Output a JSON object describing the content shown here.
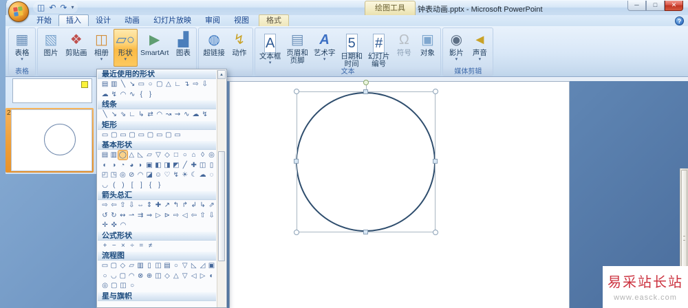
{
  "titlebar": {
    "context_header": "绘图工具",
    "title": "钟表动画.pptx - Microsoft PowerPoint",
    "qat": [
      {
        "name": "save-icon",
        "glyph": "◫"
      },
      {
        "name": "undo-icon",
        "glyph": "↶"
      },
      {
        "name": "redo-icon",
        "glyph": "↷"
      },
      {
        "name": "qat-more-icon",
        "glyph": "▾"
      }
    ],
    "window_buttons": [
      {
        "name": "minimize-button",
        "glyph": "─"
      },
      {
        "name": "maximize-button",
        "glyph": "□"
      },
      {
        "name": "close-button",
        "glyph": "✕"
      }
    ],
    "help_glyph": "?"
  },
  "tabs": [
    {
      "label": "开始",
      "active": false,
      "context": false
    },
    {
      "label": "插入",
      "active": true,
      "context": false
    },
    {
      "label": "设计",
      "active": false,
      "context": false
    },
    {
      "label": "动画",
      "active": false,
      "context": false
    },
    {
      "label": "幻灯片放映",
      "active": false,
      "context": false
    },
    {
      "label": "审阅",
      "active": false,
      "context": false
    },
    {
      "label": "视图",
      "active": false,
      "context": false
    },
    {
      "label": "格式",
      "active": false,
      "context": true
    }
  ],
  "ribbon": {
    "groups": [
      {
        "name": "tables",
        "label": "表格",
        "buttons": [
          {
            "label": "表格",
            "icon": "table-icon",
            "glyph": "▦",
            "arrow": true
          }
        ]
      },
      {
        "name": "illustrations",
        "label": "",
        "buttons": [
          {
            "label": "图片",
            "icon": "picture-icon",
            "glyph": "▧"
          },
          {
            "label": "剪贴画",
            "icon": "clipart-icon",
            "glyph": "❖"
          },
          {
            "label": "相册",
            "icon": "photo-album-icon",
            "glyph": "◫",
            "arrow": true
          },
          {
            "label": "形状",
            "icon": "shapes-icon",
            "glyph": "▱○",
            "arrow": true,
            "active": true
          },
          {
            "label": "SmartArt",
            "icon": "smartart-icon",
            "glyph": "▶"
          },
          {
            "label": "图表",
            "icon": "chart-icon",
            "glyph": "▟"
          }
        ]
      },
      {
        "name": "links",
        "label": "",
        "buttons": [
          {
            "label": "超链接",
            "icon": "hyperlink-icon",
            "glyph": "◍"
          },
          {
            "label": "动作",
            "icon": "action-icon",
            "glyph": "↯"
          }
        ]
      },
      {
        "name": "text",
        "label": "文本",
        "buttons": [
          {
            "label": "文本框",
            "icon": "textbox-icon",
            "glyph": "A",
            "arrow": true
          },
          {
            "label": "页眉和\n页脚",
            "icon": "header-footer-icon",
            "glyph": "▤"
          },
          {
            "label": "艺术字",
            "icon": "wordart-icon",
            "glyph": "A",
            "arrow": true
          },
          {
            "label": "日期和\n时间",
            "icon": "date-time-icon",
            "glyph": "5"
          },
          {
            "label": "幻灯片\n编号",
            "icon": "slide-number-icon",
            "glyph": "#"
          },
          {
            "label": "符号",
            "icon": "symbol-icon",
            "glyph": "Ω",
            "disabled": true
          },
          {
            "label": "对象",
            "icon": "object-icon",
            "glyph": "▣"
          }
        ]
      },
      {
        "name": "media",
        "label": "媒体剪辑",
        "buttons": [
          {
            "label": "影片",
            "icon": "movie-icon",
            "glyph": "◉",
            "arrow": true
          },
          {
            "label": "声音",
            "icon": "sound-icon",
            "glyph": "◄",
            "arrow": true
          }
        ]
      }
    ]
  },
  "shapes_menu": {
    "scroll_up_glyph": "▲",
    "sections": [
      {
        "title": "最近使用的形状",
        "rows": [
          [
            "▤",
            "▥",
            "╲",
            "↘",
            "▭",
            "○",
            "▢",
            "△",
            "∟",
            "↴",
            "⇨",
            "⇩"
          ],
          [
            "☁",
            "↯",
            "◠",
            "∿",
            "{",
            "}"
          ]
        ]
      },
      {
        "title": "线条",
        "rows": [
          [
            "╲",
            "↘",
            "⇘",
            "∟",
            "↳",
            "⇄",
            "◠",
            "↝",
            "⇝",
            "∿",
            "☁",
            "↯"
          ]
        ]
      },
      {
        "title": "矩形",
        "rows": [
          [
            "▭",
            "▢",
            "▭",
            "▢",
            "▭",
            "▢",
            "▭",
            "▢",
            "▭"
          ]
        ]
      },
      {
        "title": "基本形状",
        "highlighted_cell": [
          0,
          2
        ],
        "rows": [
          [
            "▤",
            "▥",
            "◯",
            "△",
            "◺",
            "▱",
            "▽",
            "◇",
            "□",
            "○",
            "⌂",
            "◊",
            "◎"
          ],
          [
            "◐",
            "◑",
            "◔",
            "◕",
            "◗",
            "▣",
            "◧",
            "◨",
            "◩",
            "╱",
            "✚",
            "◫",
            "▯"
          ],
          [
            "◰",
            "◳",
            "◎",
            "⊘",
            "◠",
            "◪",
            "☺",
            "♡",
            "↯",
            "☀",
            "☾",
            "☁",
            "◌"
          ],
          [
            "◡",
            "(",
            ")",
            "[",
            "]",
            "{",
            "}"
          ]
        ]
      },
      {
        "title": "箭头总汇",
        "rows": [
          [
            "⇨",
            "⇦",
            "⇧",
            "⇩",
            "⇔",
            "⇕",
            "✚",
            "↗",
            "↰",
            "↱",
            "↲",
            "↳",
            "⇗"
          ],
          [
            "↺",
            "↻",
            "↭",
            "⇀",
            "⇉",
            "⇒",
            "▷",
            "⊳",
            "⇨",
            "◁",
            "⇦",
            "⇧",
            "⇩"
          ],
          [
            "✛",
            "✜",
            "◠"
          ]
        ]
      },
      {
        "title": "公式形状",
        "rows": [
          [
            "+",
            "−",
            "×",
            "÷",
            "=",
            "≠"
          ]
        ]
      },
      {
        "title": "流程图",
        "rows": [
          [
            "▭",
            "▢",
            "◇",
            "▱",
            "▥",
            "▯",
            "◫",
            "▤",
            "○",
            "▽",
            "◺",
            "◿",
            "▣"
          ],
          [
            "○",
            "◡",
            "▢",
            "◠",
            "⊗",
            "⊕",
            "◫",
            "◇",
            "△",
            "▽",
            "◁",
            "▷",
            "◐"
          ],
          [
            "◎",
            "▢",
            "◫",
            "○"
          ]
        ]
      },
      {
        "title": "星与旗帜",
        "rows": []
      }
    ]
  },
  "slide_panel": {
    "slide2_number": "2"
  },
  "watermark": {
    "line1": "易采站长站",
    "line2": "www.easck.com"
  }
}
